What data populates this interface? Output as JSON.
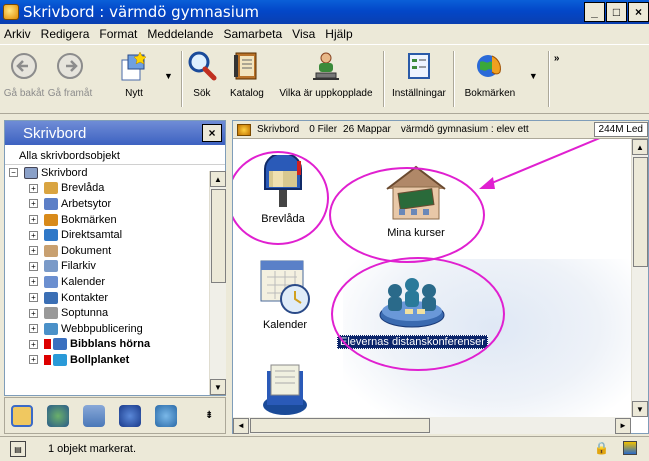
{
  "window": {
    "title": "Skrivbord : värmdö gymnasium",
    "controls": [
      "_",
      "□",
      "×"
    ]
  },
  "menu": [
    "Arkiv",
    "Redigera",
    "Format",
    "Meddelande",
    "Samarbeta",
    "Visa",
    "Hjälp"
  ],
  "toolbar": {
    "back": "Gå bakåt",
    "forward": "Gå framåt",
    "new": "Nytt",
    "search": "Sök",
    "catalog": "Katalog",
    "whos_online": "Vilka är uppkopplade",
    "settings": "Inställningar",
    "bookmarks": "Bokmärken",
    "more": "»"
  },
  "left_panel": {
    "title": "Skrivbord",
    "close": "×",
    "all_objects": "Alla skrivbordsobjekt",
    "root": "Skrivbord",
    "items": [
      {
        "label": "Brevlåda",
        "bold": false,
        "flag": false,
        "color": "#d9a441"
      },
      {
        "label": "Arbetsytor",
        "bold": false,
        "flag": false,
        "color": "#5c7fc7"
      },
      {
        "label": "Bokmärken",
        "bold": false,
        "flag": false,
        "color": "#d88a1a"
      },
      {
        "label": "Direktsamtal",
        "bold": false,
        "flag": false,
        "color": "#2f78c8"
      },
      {
        "label": "Dokument",
        "bold": false,
        "flag": false,
        "color": "#c8a070"
      },
      {
        "label": "Filarkiv",
        "bold": false,
        "flag": false,
        "color": "#7a9ac8"
      },
      {
        "label": "Kalender",
        "bold": false,
        "flag": false,
        "color": "#6b8fd0"
      },
      {
        "label": "Kontakter",
        "bold": false,
        "flag": false,
        "color": "#3b6fb5"
      },
      {
        "label": "Soptunna",
        "bold": false,
        "flag": false,
        "color": "#999999"
      },
      {
        "label": "Webbpublicering",
        "bold": false,
        "flag": false,
        "color": "#4a90c8"
      },
      {
        "label": "Bibblans hörna",
        "bold": true,
        "flag": true,
        "color": "#3a70c0"
      },
      {
        "label": "Bollplanket",
        "bold": true,
        "flag": true,
        "color": "#2a9ad8"
      }
    ]
  },
  "address_bar": {
    "location": "Skrivbord",
    "files": "0 Filer",
    "folders": "26 Mappar",
    "server": "värmdö gymnasium : elev ett",
    "space": "244M Led"
  },
  "desktop_objects": {
    "mailbox": "Brevlåda",
    "my_courses": "Mina kurser",
    "calendar": "Kalender",
    "student_conferences": "Elevernas distanskonferenser"
  },
  "status": {
    "text": "1 objekt markerat."
  },
  "colors": {
    "titlebar": "#0347c8",
    "annotation": "#e020d0",
    "selection": "#0a246a"
  }
}
